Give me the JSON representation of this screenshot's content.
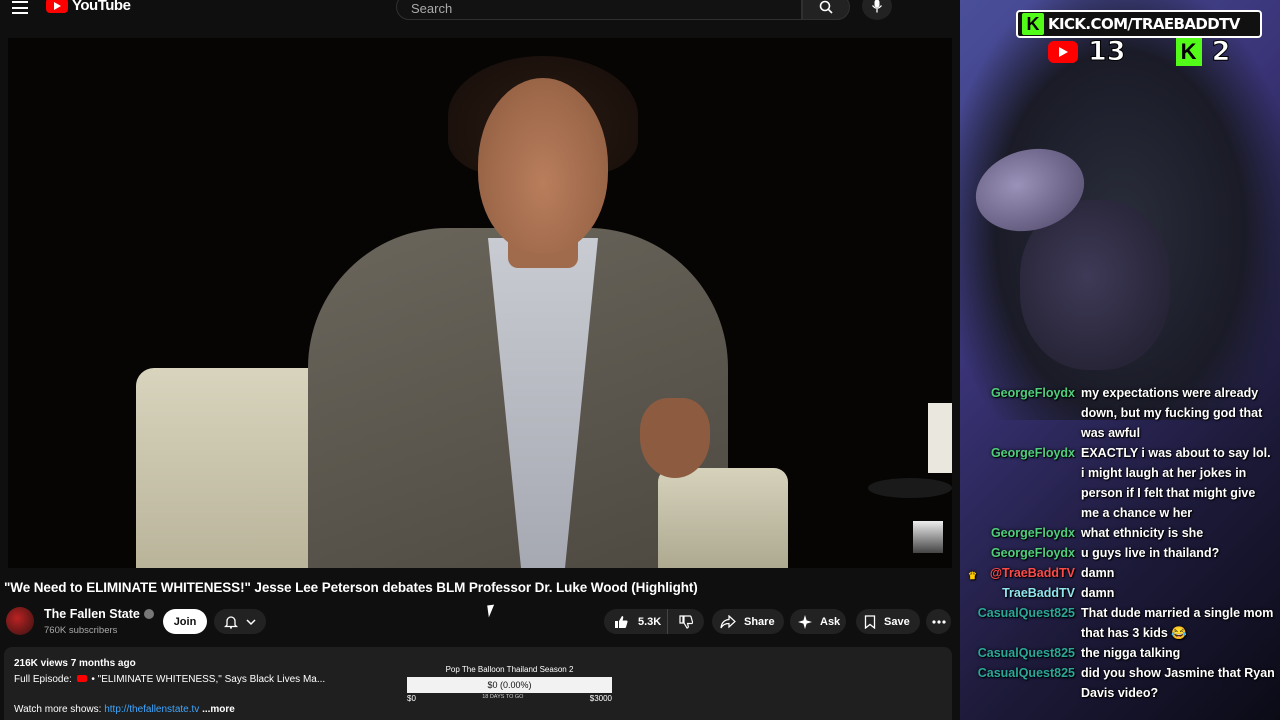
{
  "header": {
    "logo_text": "YouTube",
    "search_placeholder": "Search"
  },
  "video": {
    "title": "\"We Need to ELIMINATE WHITENESS!\" Jesse Lee Peterson debates BLM Professor Dr. Luke Wood (Highlight)"
  },
  "channel": {
    "name": "The Fallen State",
    "subscribers": "760K subscribers",
    "join_label": "Join"
  },
  "actions": {
    "likes": "5.3K",
    "share_label": "Share",
    "ask_label": "Ask",
    "save_label": "Save"
  },
  "description": {
    "meta": "216K views  7 months ago",
    "line1_prefix": "Full Episode:",
    "line1_text": "• \"ELIMINATE WHITENESS,\" Says Black Lives Ma...",
    "line2_prefix": "Watch more shows:",
    "line2_link": "http://thefallenstate.tv",
    "more_label": "...more"
  },
  "fundraiser": {
    "title": "Pop The Balloon Thailand Season 2",
    "amount": "$0 (0.00%)",
    "min": "$0",
    "days": "18 DAYS TO GO",
    "max": "$3000",
    "progress": 0
  },
  "overlay": {
    "kick_url": "KICK.COM/TRAEBADDTV",
    "youtube_count": "13",
    "kick_count": "2"
  },
  "chat": [
    {
      "user": "GeorgeFloydx",
      "text": "my expectations were already down, but my fucking god that was awful",
      "color": "#4fcf7b"
    },
    {
      "user": "GeorgeFloydx",
      "text": "EXACTLY i was about to say lol. i might laugh at her jokes in person if I felt that might give me a chance w her",
      "color": "#4fcf7b"
    },
    {
      "user": "GeorgeFloydx",
      "text": "what ethnicity is she",
      "color": "#4fcf7b"
    },
    {
      "user": "GeorgeFloydx",
      "text": "u guys live in thailand?",
      "color": "#4fcf7b"
    },
    {
      "user": "@TraeBaddTV",
      "text": "damn",
      "color": "#ff4a4a"
    },
    {
      "user": "TraeBaddTV",
      "text": "damn",
      "color": "#8fe6f0"
    },
    {
      "user": "CasualQuest825",
      "text": "That dude married a single mom that has 3 kids 😂",
      "color": "#2ba89a"
    },
    {
      "user": "CasualQuest825",
      "text": "the nigga talking",
      "color": "#2ba89a"
    },
    {
      "user": "CasualQuest825",
      "text": "did you show Jasmine that Ryan Davis video?",
      "color": "#2ba89a"
    }
  ]
}
